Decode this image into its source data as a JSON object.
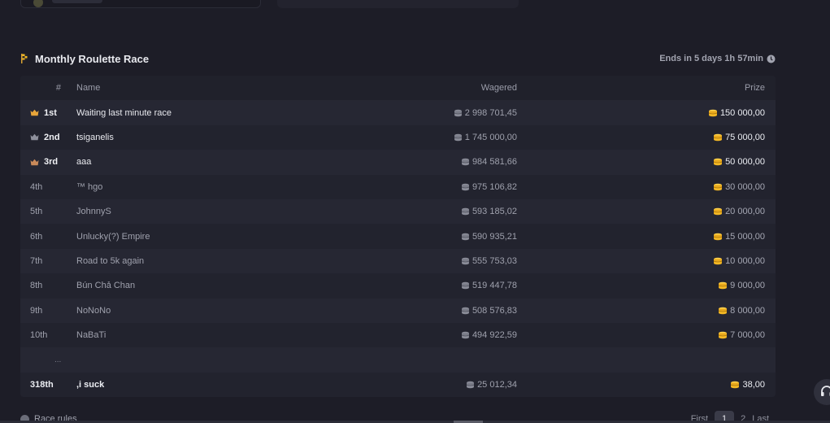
{
  "race": {
    "title": "Monthly Roulette Race",
    "ends": "Ends in 5 days 1h 57min"
  },
  "table": {
    "headers": {
      "rank": "#",
      "name": "Name",
      "wagered": "Wagered",
      "prize": "Prize"
    },
    "rows": [
      {
        "rank": "1st",
        "name": "Waiting last minute race",
        "wagered": "2 998 701,45",
        "prize": "150 000,00",
        "medal": "gold"
      },
      {
        "rank": "2nd",
        "name": "tsiganelis",
        "wagered": "1 745 000,00",
        "prize": "75 000,00",
        "medal": "silver"
      },
      {
        "rank": "3rd",
        "name": "aaa",
        "wagered": "984 581,66",
        "prize": "50 000,00",
        "medal": "bronze"
      },
      {
        "rank": "4th",
        "name": "™ hgo",
        "wagered": "975 106,82",
        "prize": "30 000,00"
      },
      {
        "rank": "5th",
        "name": "JohnnyS",
        "wagered": "593 185,02",
        "prize": "20 000,00"
      },
      {
        "rank": "6th",
        "name": "Unlucky(?) Empire",
        "wagered": "590 935,21",
        "prize": "15 000,00"
      },
      {
        "rank": "7th",
        "name": "Road to 5k again",
        "wagered": "555 753,03",
        "prize": "10 000,00"
      },
      {
        "rank": "8th",
        "name": "Bún Chả Chan",
        "wagered": "519 447,78",
        "prize": "9 000,00"
      },
      {
        "rank": "9th",
        "name": "NoNoNo",
        "wagered": "508 576,83",
        "prize": "8 000,00"
      },
      {
        "rank": "10th",
        "name": "NaBaTi",
        "wagered": "494 922,59",
        "prize": "7 000,00"
      }
    ],
    "ellipsis": "...",
    "my_row": {
      "rank": "318th",
      "name": ",i suck",
      "wagered": "25 012,34",
      "prize": "38,00"
    }
  },
  "footer": {
    "rules_label": "Race rules",
    "pager": {
      "first": "First",
      "current": "1",
      "next_page": "2",
      "last": "Last"
    }
  },
  "colors": {
    "background": "#1d1d27",
    "gold_coin": "#f4b824",
    "gray_coin": "#8a8c98",
    "medal_gold": "#e8a53a",
    "medal_silver": "#8e909c",
    "medal_bronze": "#c98a5a"
  },
  "icons": [
    "flag-icon",
    "clock-icon",
    "medal-icon",
    "coin-stack-gray-icon",
    "coin-stack-gold-icon",
    "info-icon",
    "headset-icon"
  ]
}
